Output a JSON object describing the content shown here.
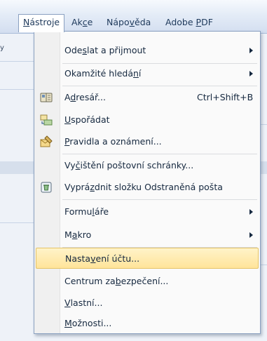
{
  "menubar": {
    "items": [
      {
        "pre": "",
        "u": "N",
        "post": "ástroje"
      },
      {
        "pre": "Ak",
        "u": "c",
        "post": "e"
      },
      {
        "pre": "Nápo",
        "u": "v",
        "post": "ěda"
      },
      {
        "pre": "Adobe ",
        "u": "P",
        "post": "DF"
      }
    ],
    "edge_left": "y"
  },
  "menu": {
    "items": [
      {
        "pre": "Ode",
        "u": "s",
        "post": "lat a přijmout",
        "shortcut": "",
        "submenu": true,
        "icon": ""
      },
      {
        "pre": "Okamžité hledá",
        "u": "n",
        "post": "í",
        "shortcut": "",
        "submenu": true,
        "icon": ""
      },
      {
        "pre": "A",
        "u": "d",
        "post": "resář...",
        "shortcut": "Ctrl+Shift+B",
        "submenu": false,
        "icon": "address-book-icon"
      },
      {
        "pre": "",
        "u": "U",
        "post": "spořádat",
        "shortcut": "",
        "submenu": false,
        "icon": "organize-icon"
      },
      {
        "pre": "",
        "u": "P",
        "post": "ravidla a oznámení...",
        "shortcut": "",
        "submenu": false,
        "icon": "rules-icon"
      },
      {
        "pre": "Vy",
        "u": "č",
        "post": "ištění poštovní schránky...",
        "shortcut": "",
        "submenu": false,
        "icon": ""
      },
      {
        "pre": "Vyprá",
        "u": "z",
        "post": "dnit složku Odstraněná pošta",
        "shortcut": "",
        "submenu": false,
        "icon": "recycle-icon"
      },
      {
        "pre": "Formu",
        "u": "l",
        "post": "áře",
        "shortcut": "",
        "submenu": true,
        "icon": ""
      },
      {
        "pre": "M",
        "u": "a",
        "post": "kro",
        "shortcut": "",
        "submenu": true,
        "icon": ""
      },
      {
        "pre": "Nasta",
        "u": "v",
        "post": "ení účtu...",
        "shortcut": "",
        "submenu": false,
        "icon": ""
      },
      {
        "pre": "Centrum za",
        "u": "b",
        "post": "ezpečení...",
        "shortcut": "",
        "submenu": false,
        "icon": ""
      },
      {
        "pre": "",
        "u": "V",
        "post": "lastní...",
        "shortcut": "",
        "submenu": false,
        "icon": ""
      },
      {
        "pre": "",
        "u": "M",
        "post": "ožnosti...",
        "shortcut": "",
        "submenu": false,
        "icon": ""
      }
    ],
    "hovered_index": 9
  },
  "colors": {
    "hover_top": "#fff3c9",
    "hover_bottom": "#ffe49a",
    "hover_border": "#e5c365",
    "menu_border": "#8aa0c0"
  }
}
